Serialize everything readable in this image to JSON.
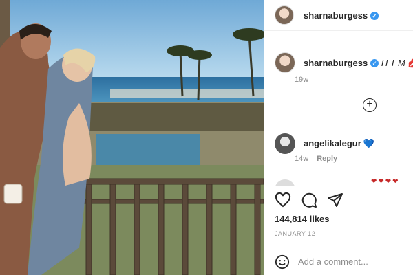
{
  "post": {
    "username": "sharnaburgess",
    "verified_icon": "verified-badge-icon"
  },
  "caption": {
    "username": "sharnaburgess",
    "text": "H I M",
    "emoji": "💋",
    "time": "19w"
  },
  "comments": [
    {
      "username": "angelikalegur",
      "emoji": "💙",
      "time": "14w",
      "reply_label": "Reply"
    }
  ],
  "actions": {
    "likes": "144,814 likes",
    "date": "JANUARY 12",
    "icons": [
      "heart-icon",
      "comment-icon",
      "share-icon"
    ]
  },
  "add_comment": {
    "placeholder": "Add a comment..."
  },
  "colors": {
    "verified": "#3897f0",
    "text": "#262626",
    "muted": "#8e8e8e"
  }
}
